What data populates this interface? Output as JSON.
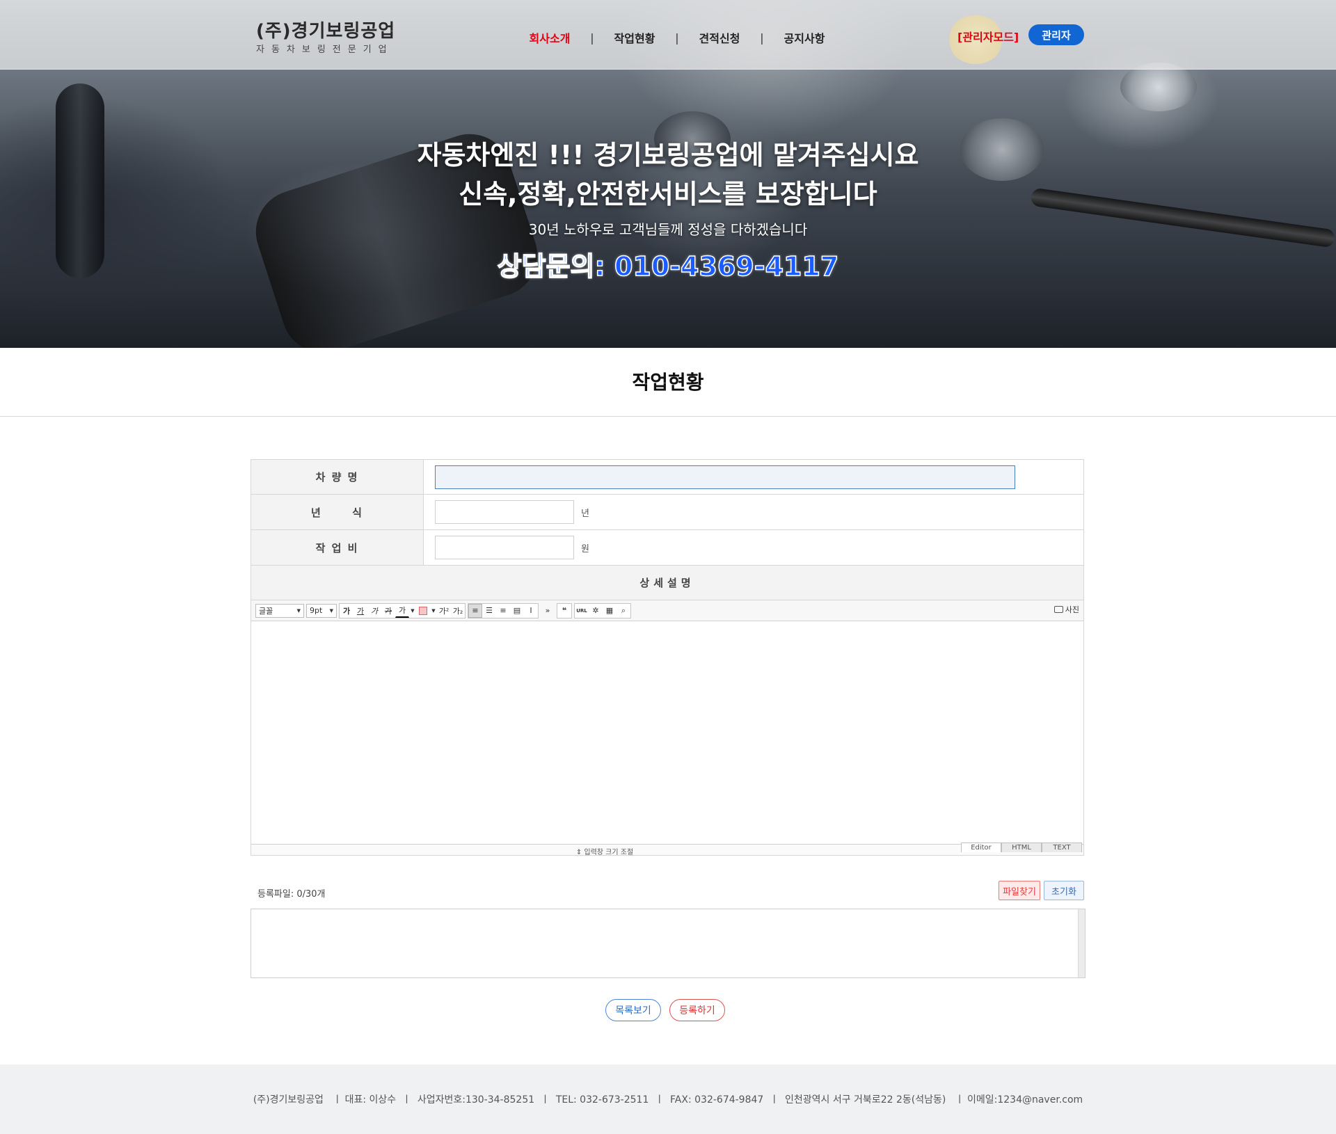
{
  "header": {
    "logo_title": "(주)경기보링공업",
    "logo_subtitle": "자동차보링전문기업",
    "nav": [
      {
        "label": "회사소개",
        "active": true
      },
      {
        "label": "작업현황",
        "active": false
      },
      {
        "label": "견적신청",
        "active": false
      },
      {
        "label": "공지사항",
        "active": false
      }
    ],
    "nav_separator": "|",
    "admin_mode_label": "[관리자모드]",
    "admin_button_label": "관리자"
  },
  "hero": {
    "line1": "자동차엔진 !!! 경기보링공업에 맡겨주십시요",
    "line2": "신속,정확,안전한서비스를 보장합니다",
    "line3": "30년 노하우로 고객님들께 정성을 다하겠습니다",
    "line4": "상담문의: 010-4369-4117"
  },
  "page": {
    "title": "작업현황"
  },
  "form": {
    "car_name_label": "차 량 명",
    "car_name_value": "",
    "year_label": "년      식",
    "year_value": "",
    "year_unit": "년",
    "cost_label": "작 업 비",
    "cost_value": "",
    "cost_unit": "원",
    "detail_label": "상세설명"
  },
  "editor": {
    "font_select": "글꼴",
    "size_select": "9pt",
    "buttons": [
      "가",
      "가",
      "가",
      "가",
      "가",
      "가²",
      "가₂"
    ],
    "url_label": "URL",
    "photo_label": "사진",
    "resize_label": "⇕ 입력창 크기 조절",
    "mode_tabs": [
      "Editor",
      "HTML",
      "TEXT"
    ],
    "active_mode": "Editor"
  },
  "files": {
    "label": "등록파일: 0/30개",
    "find_button": "파일찾기",
    "reset_button": "초기화"
  },
  "actions": {
    "list_button": "목록보기",
    "submit_button": "등록하기"
  },
  "footer": {
    "text": "(주)경기보링공업   ㅣ 대표: 이상수  ㅣ  사업자번호:130-34-85251  ㅣ  TEL: 032-673-2511  ㅣ  FAX: 032-674-9847  ㅣ  인천광역시 서구 거북로22 2동(석남동)   ㅣ 이메일:1234@naver.com"
  },
  "colors": {
    "accent_red": "#e60012",
    "accent_blue": "#1266d4",
    "hero_phone": "#1a5cff"
  }
}
